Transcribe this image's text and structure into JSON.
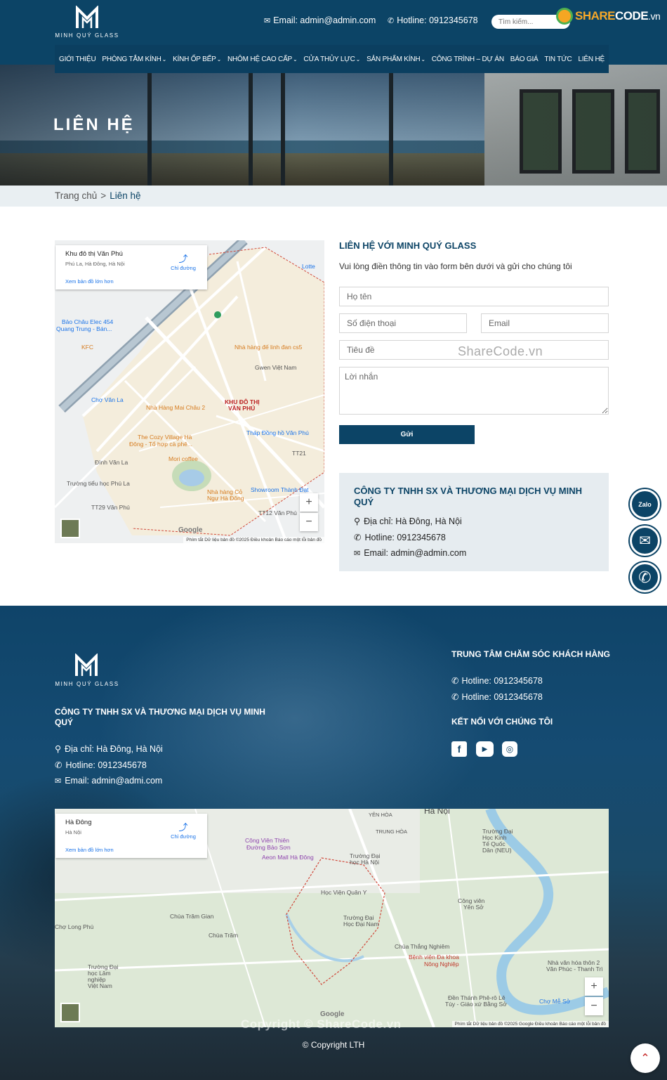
{
  "header": {
    "logo_text": "MINH QUÝ GLASS",
    "email": "Email: admin@admin.com",
    "hotline": "Hotline: 0912345678",
    "search_placeholder": "Tìm kiếm...",
    "sharecode": {
      "part1": "SHARE",
      "part2": "CODE",
      "part3": ".vn"
    }
  },
  "nav": {
    "items": [
      {
        "label": "GIỚI THIỆU",
        "dropdown": false
      },
      {
        "label": "PHÒNG TẮM KÍNH",
        "dropdown": true
      },
      {
        "label": "KÍNH ỐP BẾP",
        "dropdown": true
      },
      {
        "label": "NHÔM HỆ CAO CẤP",
        "dropdown": true
      },
      {
        "label": "CỬA THỦY LỰC",
        "dropdown": true
      },
      {
        "label": "SẢN PHẨM KÍNH",
        "dropdown": true
      },
      {
        "label": "CÔNG TRÌNH – DỰ ÁN",
        "dropdown": false
      },
      {
        "label": "BÁO GIÁ",
        "dropdown": false
      },
      {
        "label": "TIN TỨC",
        "dropdown": false
      },
      {
        "label": "LIÊN HỆ",
        "dropdown": false
      }
    ]
  },
  "banner": {
    "title": "LIÊN HỆ"
  },
  "breadcrumb": {
    "home": "Trang chủ",
    "separator": ">",
    "current": "Liên hệ"
  },
  "map1": {
    "place": "Khu đô thị Văn Phú",
    "address": "Phú La, Hà Đông, Hà Nội",
    "larger_map": "Xem bản đồ lớn hơn",
    "directions": "Chỉ đường",
    "labels": {
      "lotte": "Lotte",
      "baochau": "Bảo Châu Elec 454",
      "baochau2": "Quang Trung - Bán...",
      "kfc": "KFC",
      "nhahang_cs5": "Nhà hàng đế linh đan cs5",
      "gwen": "Gwen Việt Nam",
      "khudothi": "KHU ĐÔ THỊ",
      "khudothi2": "VĂN PHÚ",
      "chovanla": "Chợ Văn La",
      "maichau": "Nhà Hàng Mai Châu 2",
      "cozy": "The Cozy Village Hà",
      "cozy2": "Đông - Tổ hợp cà phê...",
      "thapdong": "Tháp Đồng hồ Văn Phú",
      "dinhvanla": "Đình Văn La",
      "mori": "Mori coffee",
      "truongtieuhoc": "Trường tiểu học Phú La",
      "nhahangco": "Nhà hàng Cỏ",
      "nhahangco2": "Ngự Hà Đông",
      "showroom": "Showroom Thành Đạt",
      "tt29": "TT29 Văn Phú",
      "tt12": "TT12 Văn Phú",
      "tt21": "TT21",
      "google": "Google",
      "footer": "Phím tắt   Dữ liệu bản đồ ©2025   Điều khoản   Báo cáo một lỗi bản đồ"
    },
    "zoom_in": "+",
    "zoom_out": "−"
  },
  "form": {
    "title": "LIÊN HỆ VỚI MINH QUÝ GLASS",
    "subtitle": "Vui lòng điền thông tin vào form bên dưới và gửi cho chúng tôi",
    "name_placeholder": "Họ tên",
    "phone_placeholder": "Số điện thoại",
    "email_placeholder": "Email",
    "subject_placeholder": "Tiêu đề",
    "message_placeholder": "Lời nhắn",
    "submit_label": "Gửi",
    "watermark": "ShareCode.vn"
  },
  "company_box": {
    "name": "CÔNG TY TNHH SX VÀ THƯƠNG MẠI DỊCH VỤ MINH QUÝ",
    "address": "Địa chỉ: Hà Đông, Hà Nội",
    "hotline": "Hotline: 0912345678",
    "email": "Email: admin@admin.com"
  },
  "floating": {
    "zalo": "Zalo",
    "messenger": "messenger-icon",
    "phone": "phone-icon",
    "to_top": "chevron-up-icon"
  },
  "footer": {
    "logo_text": "MINH QUÝ GLASS",
    "company": "CÔNG TY TNHH SX VÀ THƯƠNG MẠI DỊCH VỤ MINH QUÝ",
    "address": "Địa chỉ: Hà Đông, Hà Nội",
    "hotline": "Hotline: 0912345678",
    "email": "Email: admin@admi.com",
    "care_title": "TRUNG TÂM CHĂM SÓC KHÁCH HÀNG",
    "care_hotline1": "Hotline: 0912345678",
    "care_hotline2": "Hotline: 0912345678",
    "connect_title": "KẾT NỐI VỚI CHÚNG TÔI",
    "copy_watermark": "Copyright © ShareCode.vn",
    "copyright": "© Copyright LTH"
  },
  "map2": {
    "place": "Hà Đông",
    "address": "Hà Nội",
    "larger_map": "Xem bản đồ lớn hơn",
    "directions": "Chỉ đường",
    "labels": {
      "yenhoa": "YÊN HÒA",
      "trunghoa": "TRUNG HÒA",
      "congvien": "Công Viên Thiên",
      "congvien2": "Đường Bảo Sơn",
      "aeon": "Aeon Mall Hà Đông",
      "truonghanoi": "Trường Đại",
      "truonghanoi2": "học Hà Nội",
      "hocvien": "Học Viện Quân Y",
      "truongdainam": "Trường Đại",
      "truongdainam2": "Học Đại Nam",
      "chuatramgian": "Chùa Trăm Gian",
      "chuatram": "Chùa Trăm",
      "cholongphu": "Chợ Long Phú",
      "chuathang": "Chùa Thắng Nghiêm",
      "benhvien": "Bệnh viện Đa khoa",
      "benhvien2": "Nông Nghiệp",
      "truonglam": "Trường Đại",
      "truonglam2": "học Lâm",
      "truonglam3": "nghiệp",
      "truonglam4": "Việt Nam",
      "truongqt": "Trường Đại",
      "truongqt2": "Học Kinh",
      "truongqt3": "Tế Quốc",
      "truongqt4": "Dân (NEU)",
      "congvienyenso": "Công viên",
      "congvienyenso2": "Yên Sở",
      "nhavanhoa": "Nhà văn hóa thôn 2",
      "nhavanhoa2": "Văn Phúc - Thanh Trì",
      "denthanh": "Đền Thánh Phê-rô Lê",
      "denthanh2": "Tùy - Giáo xứ Bằng Sở",
      "chome": "Chợ Mễ Sở",
      "hanoi": "Hà Nội",
      "google": "Google",
      "footer": "Phím tắt   Dữ liệu bản đồ ©2025 Google   Điều khoản   Báo cáo một lỗi bản đồ"
    },
    "zoom_in": "+",
    "zoom_out": "−"
  }
}
